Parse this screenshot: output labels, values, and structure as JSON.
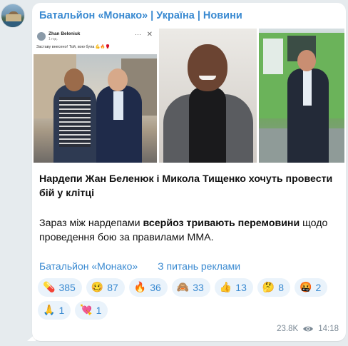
{
  "channel": {
    "name": "Батальйон «Монако» | Україна | Новини"
  },
  "media": {
    "fb_post": {
      "author": "Zhan Beleniuk",
      "time": "1 год.",
      "caption": "Заставу внесено! Той, вою була 💪🔥🥊"
    }
  },
  "post": {
    "title": "Нардепи Жан Беленюк і Микола Тищенко хочуть провести бій у клітці",
    "body_parts": {
      "p1": "Зараз між нардепами ",
      "p2": "всерйоз тривають перемовини",
      "p3": " щодо проведення бою за правилами ММА."
    }
  },
  "links": {
    "channel": "Батальйон «Монако»",
    "ads": "З питань реклами"
  },
  "reactions": [
    {
      "emoji": "💊",
      "count": "385"
    },
    {
      "emoji": "🥴",
      "count": "87"
    },
    {
      "emoji": "🔥",
      "count": "36"
    },
    {
      "emoji": "🙈",
      "count": "33"
    },
    {
      "emoji": "👍",
      "count": "13"
    },
    {
      "emoji": "🤔",
      "count": "8"
    },
    {
      "emoji": "🤬",
      "count": "2"
    },
    {
      "emoji": "🙏",
      "count": "1"
    },
    {
      "emoji": "💘",
      "count": "1"
    }
  ],
  "meta": {
    "views": "23.8K",
    "time": "14:18",
    "eye_icon": "eye-icon"
  },
  "colors": {
    "accent": "#3a8ad1",
    "background": "#e6ebee",
    "reaction_bg": "#eaf3fb"
  }
}
